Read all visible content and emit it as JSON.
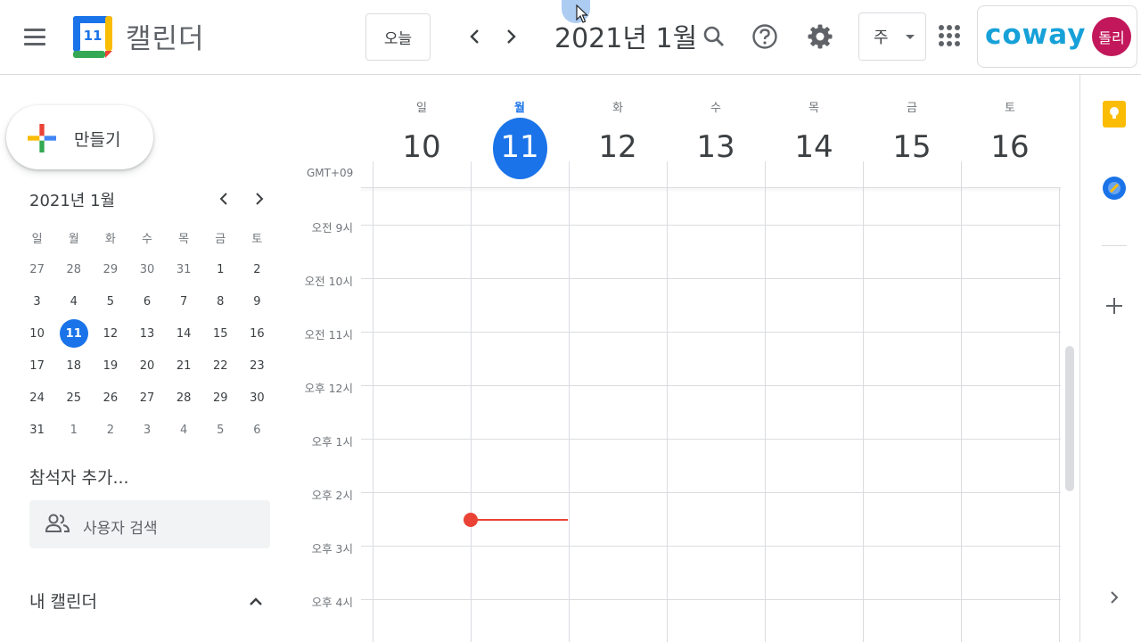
{
  "header": {
    "app_title": "캘린더",
    "logo_day": "11",
    "today_label": "오늘",
    "period_title": "2021년 1월",
    "view_label": "주",
    "brand": "coway",
    "avatar_text": "돌리"
  },
  "sidebar": {
    "create_label": "만들기",
    "mini_calendar": {
      "title": "2021년 1월",
      "weekdays": [
        "일",
        "월",
        "화",
        "수",
        "목",
        "금",
        "토"
      ],
      "weeks": [
        [
          "27",
          "28",
          "29",
          "30",
          "31",
          "1",
          "2"
        ],
        [
          "3",
          "4",
          "5",
          "6",
          "7",
          "8",
          "9"
        ],
        [
          "10",
          "11",
          "12",
          "13",
          "14",
          "15",
          "16"
        ],
        [
          "17",
          "18",
          "19",
          "20",
          "21",
          "22",
          "23"
        ],
        [
          "24",
          "25",
          "26",
          "27",
          "28",
          "29",
          "30"
        ],
        [
          "31",
          "1",
          "2",
          "3",
          "4",
          "5",
          "6"
        ]
      ],
      "today": "11"
    },
    "attendees_title": "참석자 추가...",
    "people_search_placeholder": "사용자 검색",
    "my_calendars_title": "내 캘린더"
  },
  "week": {
    "timezone": "GMT+09",
    "days": [
      {
        "dow": "일",
        "date": "10",
        "today": false
      },
      {
        "dow": "월",
        "date": "11",
        "today": true
      },
      {
        "dow": "화",
        "date": "12",
        "today": false
      },
      {
        "dow": "수",
        "date": "13",
        "today": false
      },
      {
        "dow": "목",
        "date": "14",
        "today": false
      },
      {
        "dow": "금",
        "date": "15",
        "today": false
      },
      {
        "dow": "토",
        "date": "16",
        "today": false
      }
    ],
    "time_labels": [
      "오전 9시",
      "오전 10시",
      "오전 11시",
      "오후 12시",
      "오후 1시",
      "오후 2시",
      "오후 3시",
      "오후 4시"
    ]
  },
  "colors": {
    "accent": "#1a73e8",
    "now_indicator": "#ea4335",
    "brand": "#17a1d8",
    "avatar_bg": "#c2185b"
  }
}
